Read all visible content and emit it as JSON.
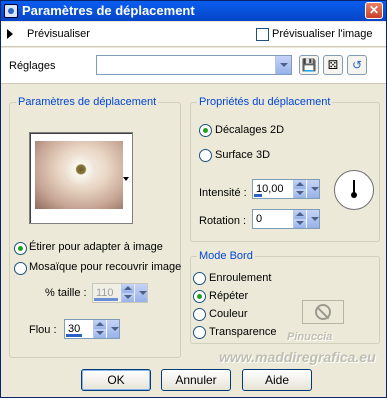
{
  "window": {
    "title": "Paramètres de déplacement",
    "close_glyph": "✕"
  },
  "preview_bar": {
    "label": "Prévisualiser",
    "checkbox_label": "Prévisualiser l'image",
    "checkbox_checked": false
  },
  "presets": {
    "label": "Réglages",
    "value": ""
  },
  "displacement_settings": {
    "title": "Paramètres de déplacement",
    "options": [
      {
        "label": "Étirer pour adapter à image",
        "selected": true
      },
      {
        "label": "Mosaïque pour recouvrir image",
        "selected": false
      }
    ],
    "size_label": "% taille :",
    "size_value": "110",
    "blur_label": "Flou :",
    "blur_value": "30"
  },
  "displacement_props": {
    "title": "Propriétés du déplacement",
    "options": [
      {
        "label": "Décalages 2D",
        "selected": true
      },
      {
        "label": "Surface 3D",
        "selected": false
      }
    ],
    "intensity_label": "Intensité :",
    "intensity_value": "10,00",
    "rotation_label": "Rotation :",
    "rotation_value": "0"
  },
  "edge_mode": {
    "title": "Mode Bord",
    "options": [
      {
        "label": "Enroulement",
        "selected": false
      },
      {
        "label": "Répéter",
        "selected": true
      },
      {
        "label": "Couleur",
        "selected": false
      },
      {
        "label": "Transparence",
        "selected": false
      }
    ]
  },
  "buttons": {
    "ok": "OK",
    "cancel": "Annuler",
    "help": "Aide"
  },
  "watermark": {
    "line1": "Pinuccia",
    "line2": "www.maddiregrafica.eu"
  }
}
